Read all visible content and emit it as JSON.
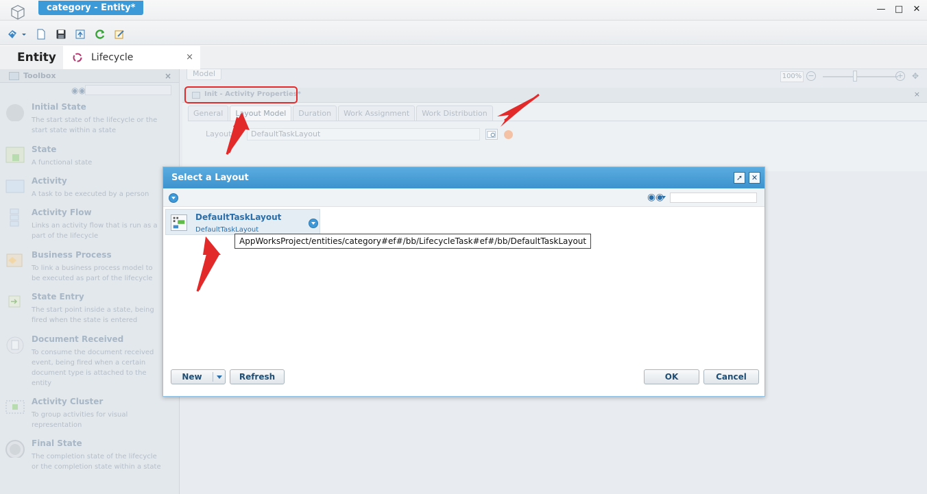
{
  "window": {
    "title": "category - Entity*"
  },
  "editor_tabs": [
    {
      "label": "Entity"
    },
    {
      "label": "Lifecycle",
      "close": "×"
    }
  ],
  "toolbox": {
    "title": "Toolbox",
    "close": "×",
    "items": [
      {
        "name": "Initial State",
        "desc": "The start state of the lifecycle or the start state within a state"
      },
      {
        "name": "State",
        "desc": "A functional state"
      },
      {
        "name": "Activity",
        "desc": "A task to be executed by a person"
      },
      {
        "name": "Activity Flow",
        "desc": "Links an activity flow that is run as a part of the lifecycle"
      },
      {
        "name": "Business Process",
        "desc": "To link a business process model to be executed as part of the lifecycle"
      },
      {
        "name": "State Entry",
        "desc": "The start point inside a state, being fired when the state is entered"
      },
      {
        "name": "Document Received",
        "desc": "To consume the document received event, being fired when a certain document type is attached to the entity"
      },
      {
        "name": "Activity Cluster",
        "desc": "To group activities for visual representation"
      },
      {
        "name": "Final State",
        "desc": "The completion state of the lifecycle or the completion state within a state"
      }
    ]
  },
  "canvas": {
    "model_tab": "Model",
    "zoom": "100%"
  },
  "properties": {
    "title": "Init - Activity Properties*",
    "close": "×",
    "tabs": [
      "General",
      "Layout Model",
      "Duration",
      "Work Assignment",
      "Work Distribution"
    ],
    "active_tab": "Layout Model",
    "layout_label": "Layout",
    "layout_value": "DefaultTaskLayout"
  },
  "dialog": {
    "title": "Select a Layout",
    "item": {
      "name": "DefaultTaskLayout",
      "subtitle": "DefaultTaskLayout",
      "tooltip": "AppWorksProject/entities/category#ef#/bb/LifecycleTask#ef#/bb/DefaultTaskLayout"
    },
    "buttons": {
      "new": "New",
      "refresh": "Refresh",
      "ok": "OK",
      "cancel": "Cancel"
    }
  },
  "colors": {
    "accent": "#3d9ad8",
    "annotation": "#e32a2a"
  }
}
